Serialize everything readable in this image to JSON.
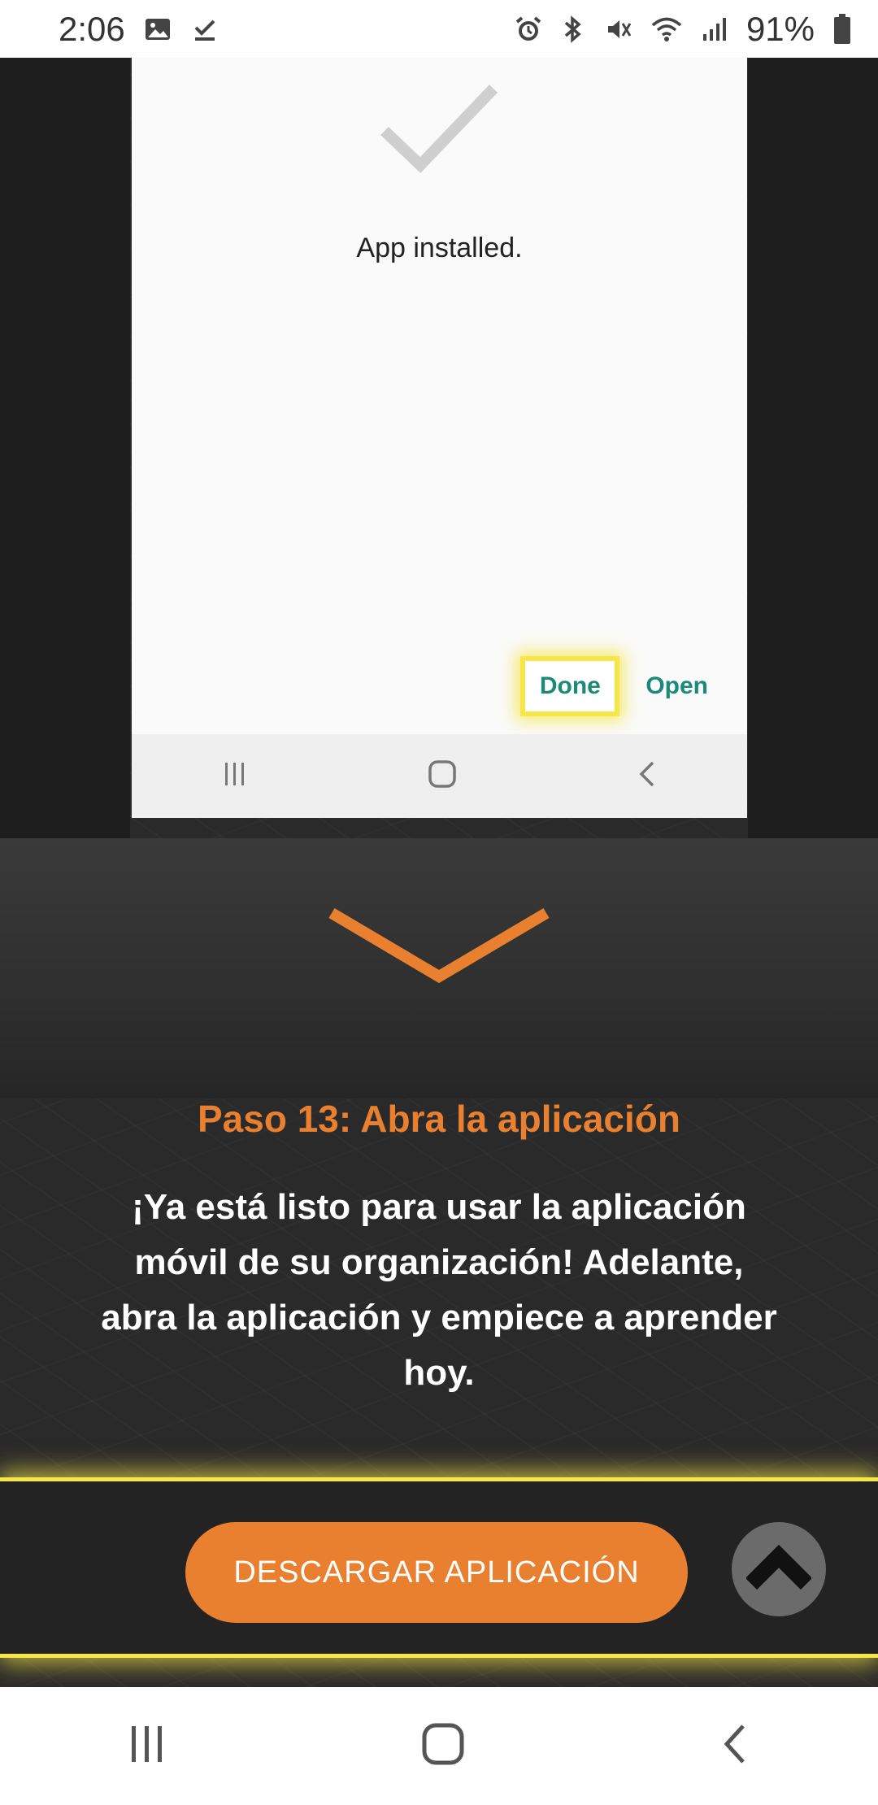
{
  "status_bar": {
    "time": "2:06",
    "icons_left": [
      "image-icon",
      "check-download-icon"
    ],
    "icons_right": [
      "alarm-icon",
      "bluetooth-icon",
      "vibrate-icon",
      "wifi-icon",
      "signal-icon",
      "battery-icon"
    ],
    "battery": "91%"
  },
  "install_dialog": {
    "message": "App installed.",
    "done_label": "Done",
    "open_label": "Open"
  },
  "step": {
    "title": "Paso 13: Abra la aplicación",
    "body": "¡Ya está listo para usar la aplicación móvil de su organización! Adelante, abra la aplicación y empiece a aprender hoy."
  },
  "download": {
    "button_label": "DESCARGAR APLICACIÓN"
  },
  "colors": {
    "accent": "#e8802f",
    "highlight": "#f5e64a",
    "dialog_button": "#1a8a7a",
    "page_bg": "#2a2a2a"
  }
}
